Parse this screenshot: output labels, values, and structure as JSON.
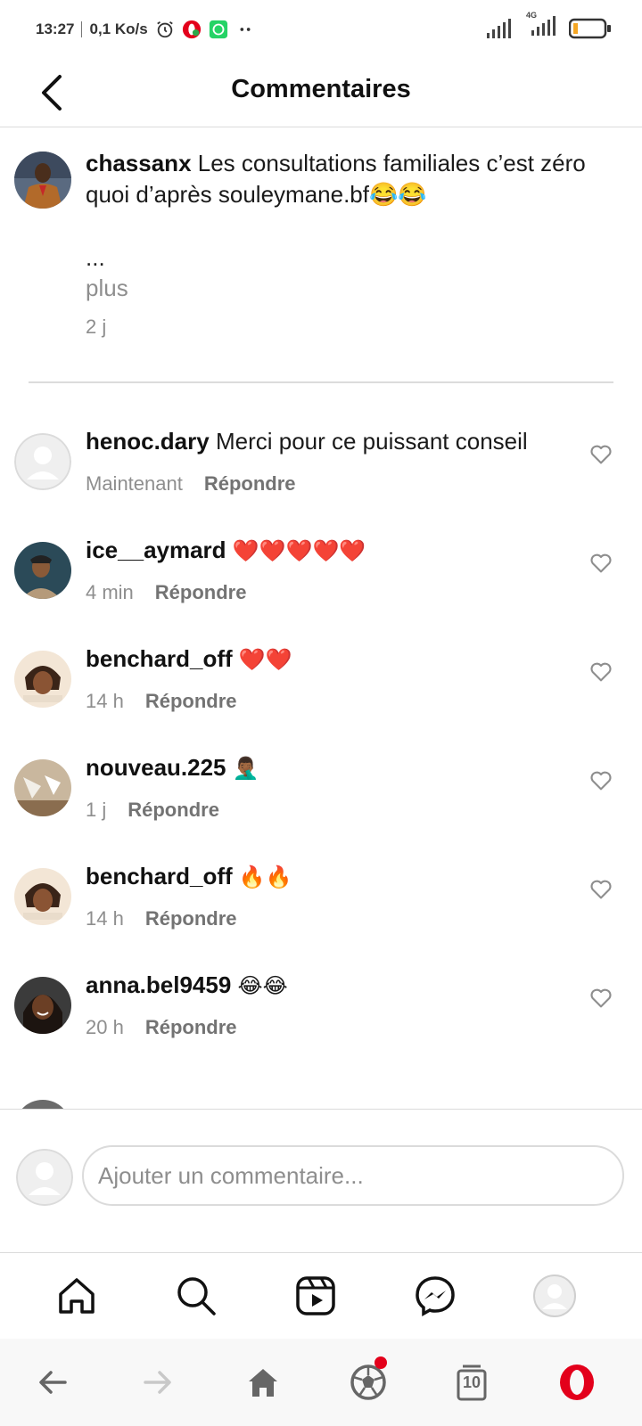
{
  "status_bar": {
    "time": "13:27",
    "network_speed": "0,1 Ko/s",
    "network_type": "4G",
    "icons": [
      "alarm-icon",
      "opera-notification-icon",
      "whatsapp-icon",
      "more-dots-icon",
      "signal-icon",
      "signal-4g-icon",
      "battery-icon"
    ]
  },
  "header": {
    "title": "Commentaires",
    "back_icon": "chevron-left-icon"
  },
  "caption": {
    "username": "chassanx",
    "text": "Les consultations familiales c’est zéro quoi d’après souleymane.bf😂😂",
    "ellipsis": "...",
    "more": "plus",
    "time": "2 j"
  },
  "comments": [
    {
      "username": "henoc.dary",
      "text": "Merci pour ce puissant conseil",
      "time": "Maintenant",
      "reply": "Répondre"
    },
    {
      "username": "ice__aymard",
      "text": "❤️❤️❤️❤️❤️",
      "time": "4 min",
      "reply": "Répondre"
    },
    {
      "username": "benchard_off",
      "text": "❤️❤️",
      "time": "14 h",
      "reply": "Répondre"
    },
    {
      "username": "nouveau.225",
      "text": "🤦🏾‍♂️",
      "time": "1 j",
      "reply": "Répondre"
    },
    {
      "username": "benchard_off",
      "text": "🔥🔥",
      "time": "14 h",
      "reply": "Répondre"
    },
    {
      "username": "anna.bel9459",
      "text": "😂😂",
      "time": "20 h",
      "reply": "Répondre"
    }
  ],
  "composer": {
    "placeholder": "Ajouter un commentaire..."
  },
  "app_nav": [
    "home-icon",
    "search-icon",
    "reels-icon",
    "messenger-icon",
    "profile-avatar"
  ],
  "browser_bar": {
    "tab_count": "10",
    "icons": [
      "back-arrow-icon",
      "forward-arrow-icon",
      "home-icon",
      "football-icon",
      "tabs-icon",
      "opera-icon"
    ]
  },
  "colors": {
    "muted_text": "#8e8e8e",
    "divider": "#dbdbdb",
    "opera_red": "#e3001b",
    "whatsapp_green": "#25d366"
  }
}
